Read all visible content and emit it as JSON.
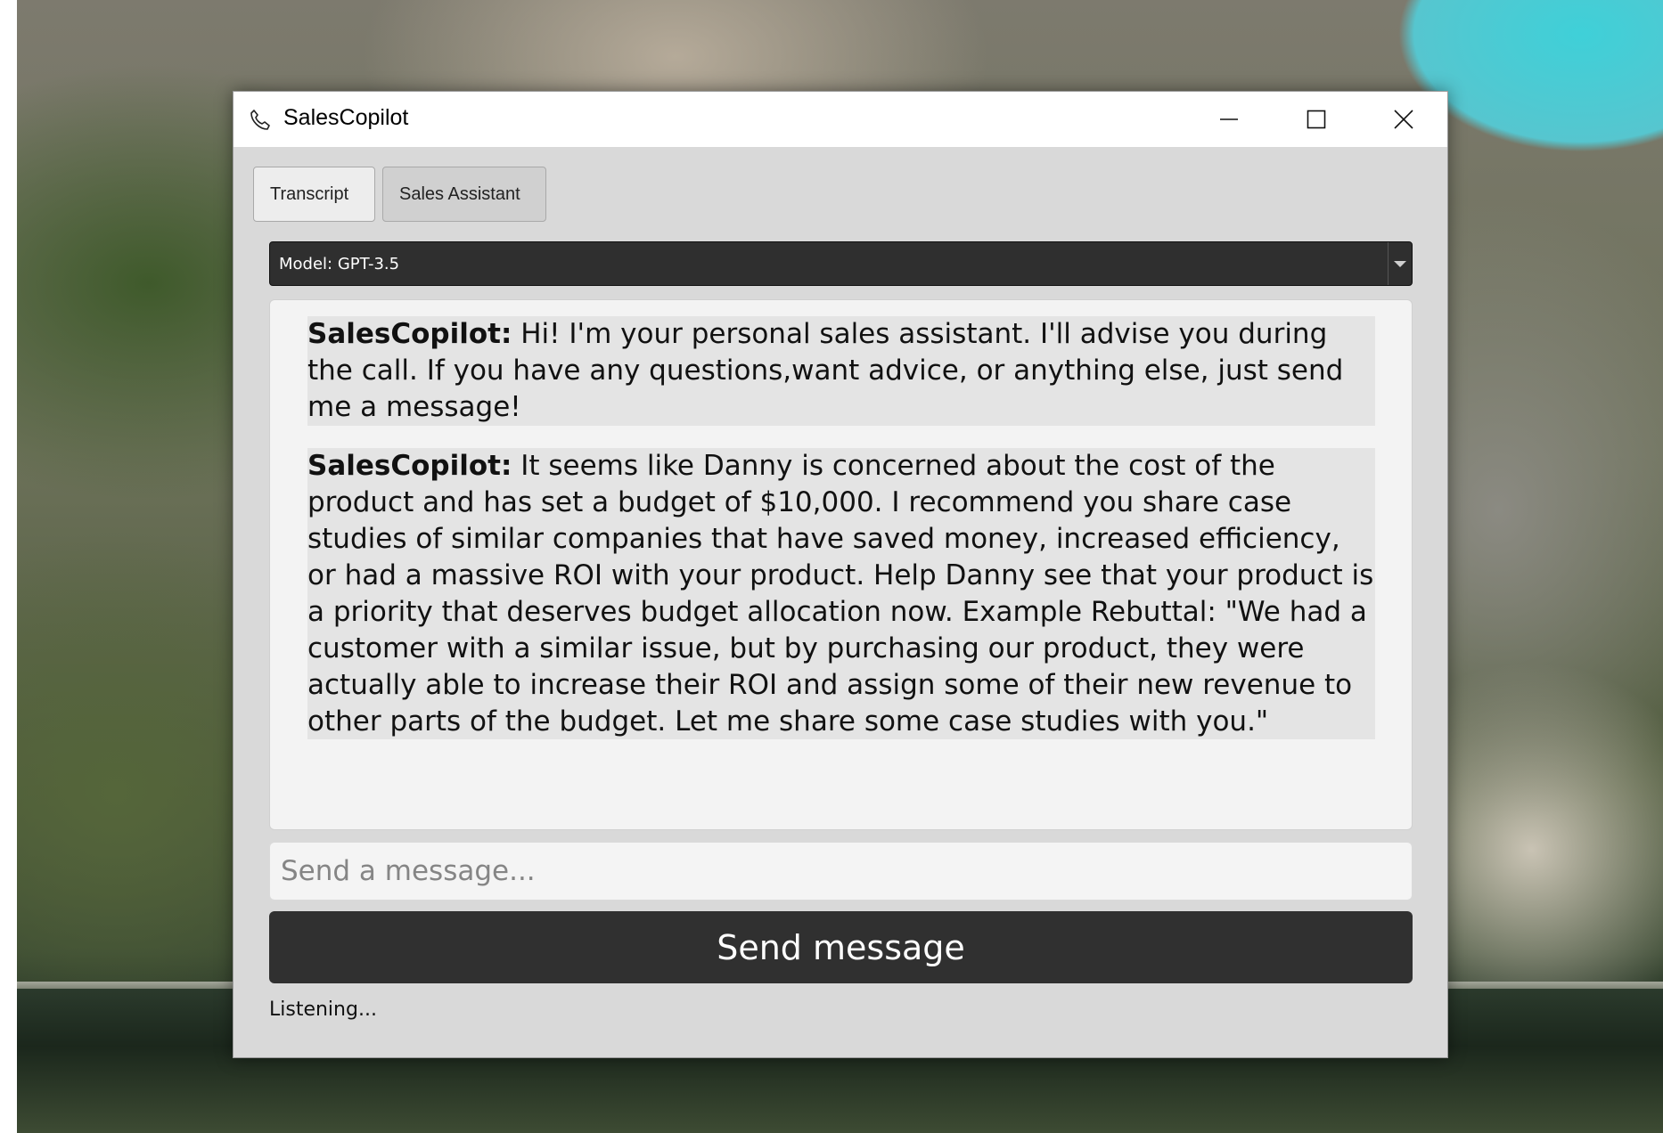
{
  "window": {
    "title": "SalesCopilot",
    "icon": "phone-icon"
  },
  "tabs": [
    {
      "label": "Transcript"
    },
    {
      "label": "Sales Assistant"
    }
  ],
  "model_select": {
    "selected": "Model: GPT-3.5"
  },
  "messages": [
    {
      "sender": "SalesCopilot:",
      "text": " Hi! I'm your personal sales assistant. I'll advise you during the call. If you have any questions,want advice, or anything else, just send me a message!"
    },
    {
      "sender": "SalesCopilot:",
      "text": " It seems like Danny is concerned about the cost of the product and has set a budget of $10,000. I recommend you share case studies of similar companies that have saved money, increased efficiency, or had a massive ROI with your product. Help Danny see that your product is a priority that deserves budget allocation now. Example Rebuttal: \"We had a customer with a similar issue, but by purchasing our product, they were actually able to increase their ROI and assign some of their new revenue to other parts of the budget. Let me share some case studies with you.\""
    }
  ],
  "composer": {
    "placeholder": "Send a message...",
    "value": "",
    "send_label": "Send message"
  },
  "status": "Listening..."
}
